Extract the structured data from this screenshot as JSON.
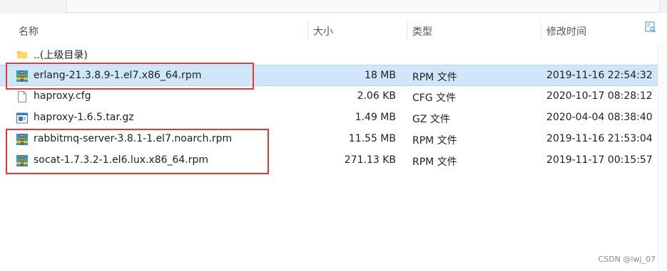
{
  "header": {
    "name": "名称",
    "size": "大小",
    "type": "类型",
    "modified": "修改时间"
  },
  "rows": [
    {
      "name": "..(上级目录)",
      "size": "",
      "type": "",
      "date": "",
      "icon": "folder-icon"
    },
    {
      "name": "erlang-21.3.8.9-1.el7.x86_64.rpm",
      "size": "18 MB",
      "type": "RPM 文件",
      "date": "2019-11-16 22:54:32",
      "icon": "archive-icon",
      "selected": true
    },
    {
      "name": "haproxy.cfg",
      "size": "2.06 KB",
      "type": "CFG 文件",
      "date": "2020-10-17 08:28:12",
      "icon": "document-icon"
    },
    {
      "name": "haproxy-1.6.5.tar.gz",
      "size": "1.49 MB",
      "type": "GZ 文件",
      "date": "2020-04-04 08:38:40",
      "icon": "gz-archive-icon"
    },
    {
      "name": "rabbitmq-server-3.8.1-1.el7.noarch.rpm",
      "size": "11.55 MB",
      "type": "RPM 文件",
      "date": "2019-11-16 21:53:04",
      "icon": "archive-icon"
    },
    {
      "name": "socat-1.7.3.2-1.el6.lux.x86_64.rpm",
      "size": "271.13 KB",
      "type": "RPM 文件",
      "date": "2019-11-17 00:15:57",
      "icon": "archive-icon"
    }
  ],
  "watermark": "CSDN @lwj_07",
  "colors": {
    "selection": "#cfe6fb",
    "highlight_box": "#e53935"
  }
}
